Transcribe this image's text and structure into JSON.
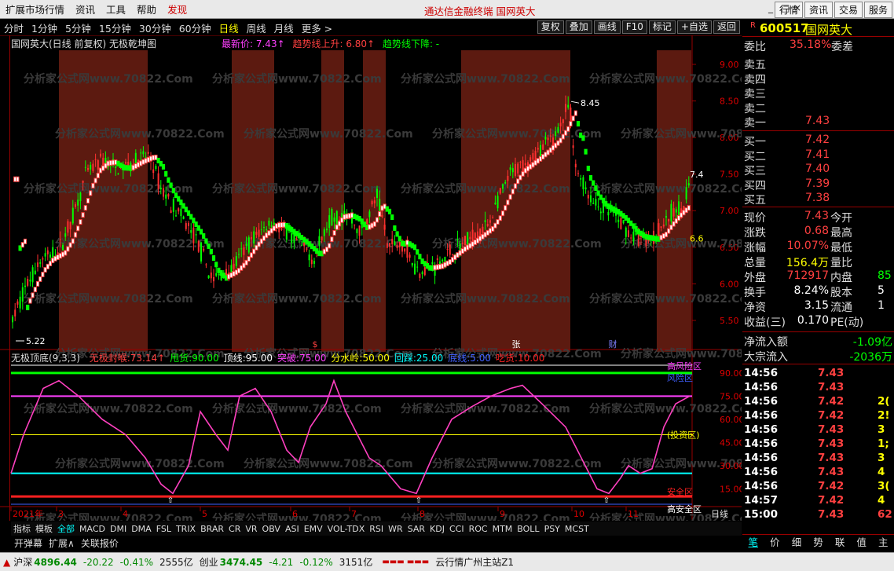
{
  "menubar": {
    "items": [
      "扩展市场行情",
      "资讯",
      "工具",
      "帮助",
      "发现"
    ],
    "center": "通达信金融终端   国网英大",
    "right_buttons": [
      "行情",
      "资讯",
      "交易",
      "服务"
    ],
    "win": [
      "_",
      "□",
      "×"
    ]
  },
  "periods": [
    "分时",
    "1分钟",
    "5分钟",
    "15分钟",
    "30分钟",
    "60分钟",
    "日线",
    "周线",
    "月线",
    "更多 >"
  ],
  "active_period": "日线",
  "toolbar": [
    "复权",
    "叠加",
    "画线",
    "F10",
    "标记",
    "+自选",
    "返回"
  ],
  "chart": {
    "title": "国网英大(日线 前复权) 无极乾坤图",
    "latest_label": "最新价: 7.43↑",
    "up_label": "趋势线上升: 6.80↑",
    "down_label": "趋势线下降: -",
    "high_annot": "8.45",
    "low_annot": "5.22",
    "last_annot": "7.4",
    "trend_annot": "6.6",
    "event_s": "$",
    "event_zhang": "张",
    "event_cai": "财",
    "yticks": [
      "9.00",
      "8.50",
      "8.00",
      "7.50",
      "7.00",
      "6.50",
      "6.00",
      "5.50"
    ],
    "xlabels": [
      "2021年",
      "3",
      "4",
      "5",
      "6",
      "7",
      "8",
      "9",
      "10",
      "11"
    ],
    "watermark": "分析家公式网www.70822.Com"
  },
  "osc": {
    "title": "无极顶底(9,3,3)",
    "params": [
      {
        "label": "无极封喉:",
        "value": "73.14↑",
        "color": "#ff4040"
      },
      {
        "label": "甩货:",
        "value": "90.00",
        "color": "#00ff00"
      },
      {
        "label": "顶线:",
        "value": "95.00",
        "color": "#ffffff"
      },
      {
        "label": "突破:",
        "value": "75.00",
        "color": "#ff40ff"
      },
      {
        "label": "分水岭:",
        "value": "50.00",
        "color": "#ffff00"
      },
      {
        "label": "回踩:",
        "value": "25.00",
        "color": "#00ffff"
      },
      {
        "label": "底线:",
        "value": "5.00",
        "color": "#4060ff"
      },
      {
        "label": "吃货:",
        "value": "10.00",
        "color": "#ff2020"
      }
    ],
    "yticks": [
      "90.00",
      "75.00",
      "60.00",
      "45.00",
      "30.00",
      "15.00"
    ],
    "zones": {
      "high_risk": "高风险区",
      "risk": "风险区",
      "invest": "(投资区)",
      "safe": "安全区",
      "high_safe": "高安全区"
    },
    "period_label": "日线"
  },
  "bottom_tabs": [
    "指标",
    "模板",
    "全部",
    "MACD",
    "DMI",
    "DMA",
    "FSL",
    "TRIX",
    "BRAR",
    "CR",
    "VR",
    "OBV",
    "ASI",
    "EMV",
    "VOL-TDX",
    "RSI",
    "WR",
    "SAR",
    "KDJ",
    "CCI",
    "ROC",
    "MTM",
    "BOLL",
    "PSY",
    "MCST"
  ],
  "bottom_active": "全部",
  "ext_bar": [
    "开弹幕",
    "扩展∧",
    "关联报价"
  ],
  "quote": {
    "code": "600517",
    "name": "国网英大",
    "flag": "R",
    "weibi_label": "委比",
    "weibi": "35.18%",
    "weicha_label": "委差",
    "sell": [
      {
        "label": "卖五",
        "price": ""
      },
      {
        "label": "卖四",
        "price": ""
      },
      {
        "label": "卖三",
        "price": ""
      },
      {
        "label": "卖二",
        "price": ""
      },
      {
        "label": "卖一",
        "price": "7.43"
      }
    ],
    "buy": [
      {
        "label": "买一",
        "price": "7.42"
      },
      {
        "label": "买二",
        "price": "7.41"
      },
      {
        "label": "买三",
        "price": "7.40"
      },
      {
        "label": "买四",
        "price": "7.39"
      },
      {
        "label": "买五",
        "price": "7.38"
      }
    ],
    "stats": [
      {
        "l1": "现价",
        "v1": "7.43",
        "c1": "#ff4040",
        "l2": "今开",
        "v2": ""
      },
      {
        "l1": "涨跌",
        "v1": "0.68",
        "c1": "#ff4040",
        "l2": "最高",
        "v2": ""
      },
      {
        "l1": "涨幅",
        "v1": "10.07%",
        "c1": "#ff4040",
        "l2": "最低",
        "v2": ""
      },
      {
        "l1": "总量",
        "v1": "156.4万",
        "c1": "#ffff00",
        "l2": "量比",
        "v2": ""
      },
      {
        "l1": "外盘",
        "v1": "712917",
        "c1": "#ff4040",
        "l2": "内盘",
        "v2": "85",
        "c2": "#00ff00"
      },
      {
        "l1": "换手",
        "v1": "8.24%",
        "c1": "#ffffff",
        "l2": "股本",
        "v2": "5",
        "c2": "#ffffff"
      },
      {
        "l1": "净资",
        "v1": "3.15",
        "c1": "#ffffff",
        "l2": "流通",
        "v2": "1",
        "c2": "#ffffff"
      },
      {
        "l1": "收益(三)",
        "v1": "0.170",
        "c1": "#ffffff",
        "l2": "PE(动)",
        "v2": ""
      }
    ],
    "flow": [
      {
        "label": "净流入额",
        "value": "-1.09亿",
        "color": "#00ff00"
      },
      {
        "label": "大宗流入",
        "value": "-2036万",
        "color": "#00ff00"
      }
    ],
    "ticks": [
      {
        "t": "14:56",
        "p": "7.43",
        "v": "",
        "c": "#ff4040"
      },
      {
        "t": "14:56",
        "p": "7.43",
        "v": "",
        "c": "#ff4040"
      },
      {
        "t": "14:56",
        "p": "7.42",
        "v": "2(",
        "c": "#ff4040"
      },
      {
        "t": "14:56",
        "p": "7.42",
        "v": "2!",
        "c": "#ff4040"
      },
      {
        "t": "14:56",
        "p": "7.43",
        "v": "3",
        "c": "#ff4040"
      },
      {
        "t": "14:56",
        "p": "7.43",
        "v": "1;",
        "c": "#ff4040"
      },
      {
        "t": "14:56",
        "p": "7.43",
        "v": "3",
        "c": "#ff4040"
      },
      {
        "t": "14:56",
        "p": "7.43",
        "v": "4",
        "c": "#ff4040"
      },
      {
        "t": "14:56",
        "p": "7.42",
        "v": "3(",
        "c": "#ff4040"
      },
      {
        "t": "14:57",
        "p": "7.42",
        "v": "4",
        "c": "#ff4040"
      },
      {
        "t": "15:00",
        "p": "7.43",
        "v": "62",
        "c": "#ff4040"
      }
    ]
  },
  "rtabs": [
    "笔",
    "价",
    "细",
    "势",
    "联",
    "值",
    "主"
  ],
  "rtabs_active": "笔",
  "status": {
    "sh_label": "沪深",
    "sh_val": "4896.44",
    "sh_chg": "-20.22",
    "sh_pct": "-0.41%",
    "sh_amt": "2555亿",
    "cy_label": "创业",
    "cy_val": "3474.45",
    "cy_chg": "-4.21",
    "cy_pct": "-0.12%",
    "cy_amt": "3151亿",
    "server": "云行情广州主站Z1"
  },
  "colors": {
    "up": "#ff3030",
    "down": "#00ff00",
    "band": "#5c1a10",
    "grid": "#990000"
  }
}
